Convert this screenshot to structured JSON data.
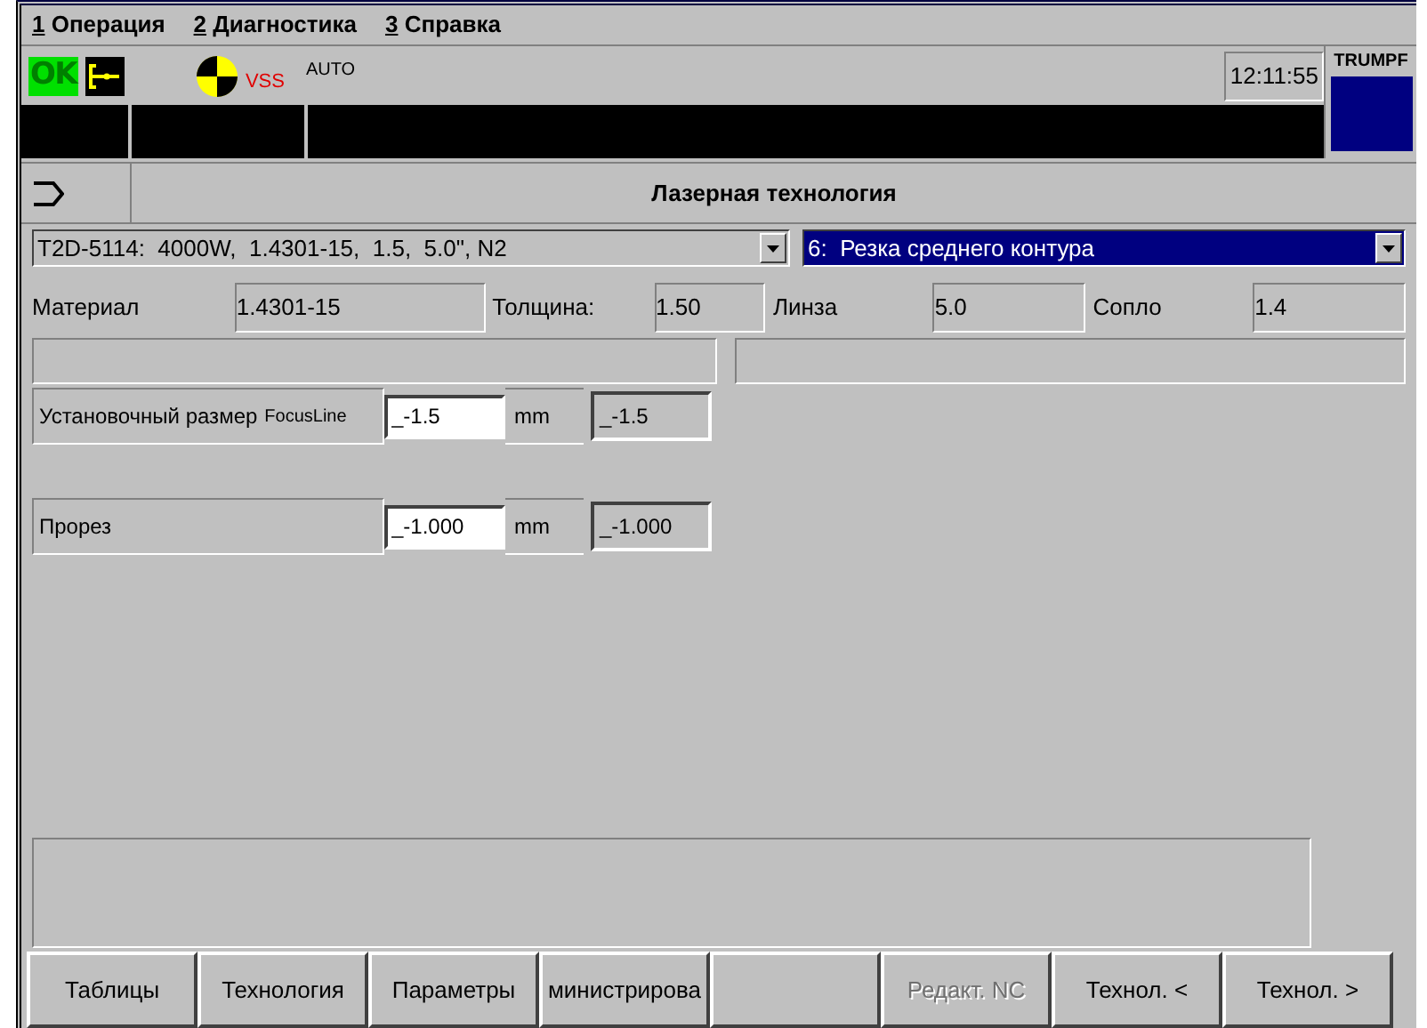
{
  "menu": [
    {
      "key": "1",
      "label": "Операция"
    },
    {
      "key": "2",
      "label": "Диагностика"
    },
    {
      "key": "3",
      "label": "Справка"
    }
  ],
  "status": {
    "ok": "OK",
    "vss": "VSS",
    "mode": "AUTO",
    "time": "12:11:55",
    "brand": "TRUMPF"
  },
  "title": "Лазерная технология",
  "technology_select": {
    "value": "T2D-5114:  4000W,  1.4301-15,  1.5,  5.0\", N2"
  },
  "cut_select": {
    "value": "6:  Резка среднего контура"
  },
  "info": [
    {
      "label": "Материал",
      "value": "1.4301-15"
    },
    {
      "label": "Толщина:",
      "value": "1.50"
    },
    {
      "label": "Линза",
      "value": "5.0"
    },
    {
      "label": "Сопло",
      "value": "1.4"
    }
  ],
  "params": [
    {
      "label": "Установочный размер",
      "sublabel": "FocusLine",
      "value": "_-1.5",
      "unit": "mm",
      "actual": "_-1.5"
    },
    {
      "label": "Прорез",
      "value": "_-1.000",
      "unit": "mm",
      "actual": "_-1.000"
    }
  ],
  "softkeys": [
    {
      "kind": "key",
      "label": "Таблицы",
      "disabled": false
    },
    {
      "kind": "key",
      "label": "Технология",
      "disabled": false
    },
    {
      "kind": "key",
      "label": "Параметры",
      "disabled": false
    },
    {
      "kind": "key",
      "label": "министрирова",
      "disabled": false
    },
    {
      "kind": "blank"
    },
    {
      "kind": "key",
      "label": "Редакт. NC",
      "disabled": true
    },
    {
      "kind": "key",
      "label": "Технол. <",
      "disabled": false
    },
    {
      "kind": "key",
      "label": "Технол. >",
      "disabled": false
    }
  ]
}
